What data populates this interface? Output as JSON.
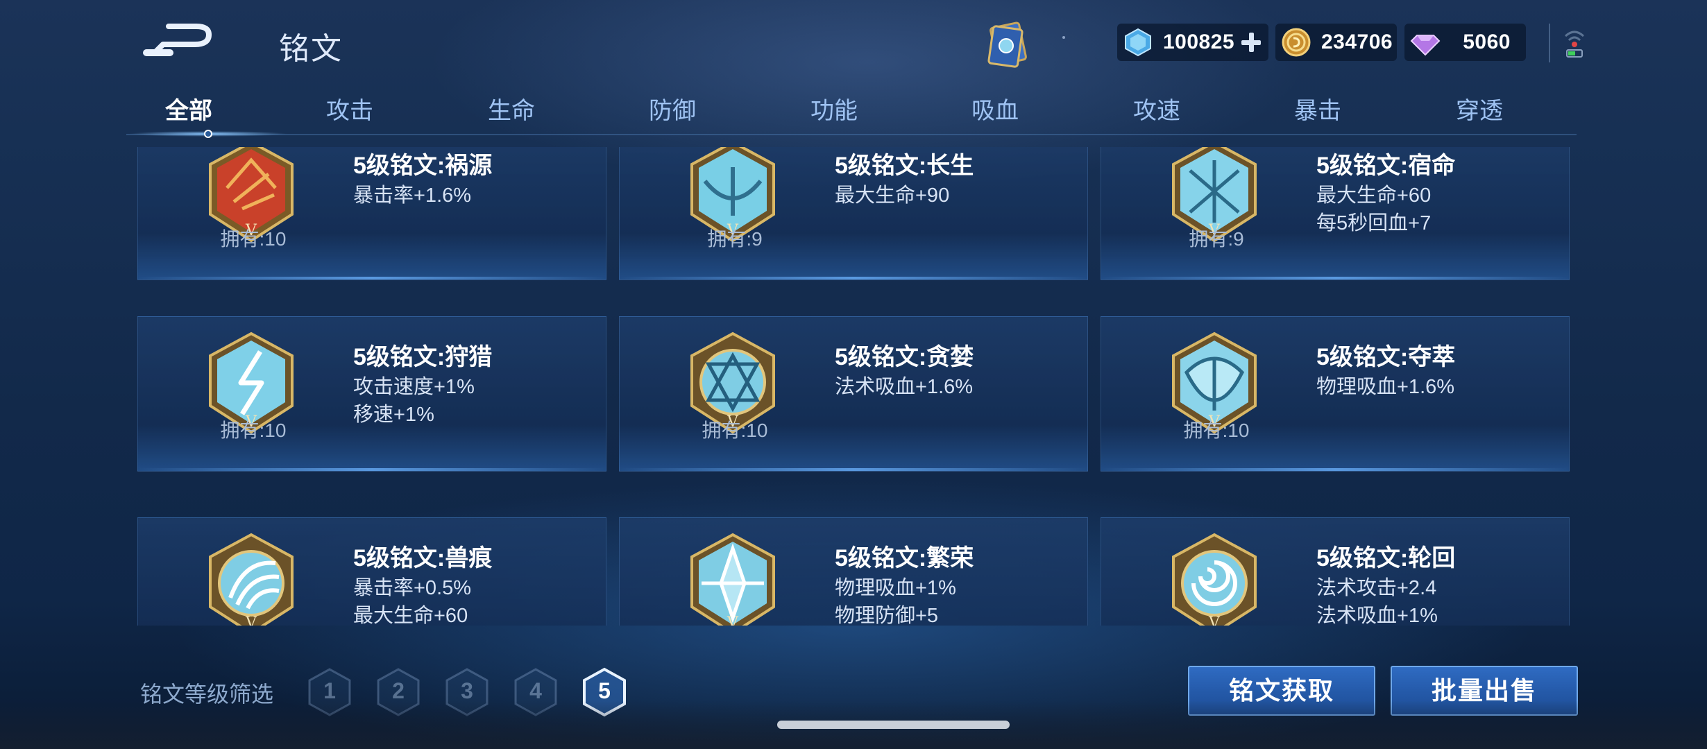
{
  "header": {
    "title": "铭文",
    "back_icon": "back-arrow-icon",
    "book_icon": "inscription-book-icon"
  },
  "currencies": [
    {
      "name": "gem",
      "icon": "blue-gem-icon",
      "amount": "100825",
      "has_plus": true
    },
    {
      "name": "coin",
      "icon": "gold-coin-icon",
      "amount": "234706"
    },
    {
      "name": "diamond",
      "icon": "purple-diamond-icon",
      "amount": "5060"
    }
  ],
  "tabs": [
    {
      "label": "全部",
      "active": true
    },
    {
      "label": "攻击"
    },
    {
      "label": "生命"
    },
    {
      "label": "防御"
    },
    {
      "label": "功能"
    },
    {
      "label": "吸血"
    },
    {
      "label": "攻速"
    },
    {
      "label": "暴击"
    },
    {
      "label": "穿透"
    }
  ],
  "runes": [
    {
      "title": "5级铭文:祸源",
      "stats": [
        "暴击率+1.6%",
        ""
      ],
      "owned": "拥有:10",
      "emblem": "red"
    },
    {
      "title": "5级铭文:长生",
      "stats": [
        "最大生命+90",
        ""
      ],
      "owned": "拥有:9",
      "emblem": "blue"
    },
    {
      "title": "5级铭文:宿命",
      "stats": [
        "最大生命+60",
        "每5秒回血+7"
      ],
      "owned": "拥有:9",
      "emblem": "blue"
    },
    {
      "title": "5级铭文:狩猎",
      "stats": [
        "攻击速度+1%",
        "移速+1%"
      ],
      "owned": "拥有:10",
      "emblem": "blue"
    },
    {
      "title": "5级铭文:贪婪",
      "stats": [
        "法术吸血+1.6%",
        ""
      ],
      "owned": "拥有:10",
      "emblem": "blue"
    },
    {
      "title": "5级铭文:夺萃",
      "stats": [
        "物理吸血+1.6%",
        ""
      ],
      "owned": "拥有:10",
      "emblem": "blue"
    },
    {
      "title": "5级铭文:兽痕",
      "stats": [
        "暴击率+0.5%",
        "最大生命+60"
      ],
      "owned": "",
      "emblem": "blue"
    },
    {
      "title": "5级铭文:繁荣",
      "stats": [
        "物理吸血+1%",
        "物理防御+5"
      ],
      "owned": "",
      "emblem": "blue"
    },
    {
      "title": "5级铭文:轮回",
      "stats": [
        "法术攻击+2.4",
        "法术吸血+1%"
      ],
      "owned": "",
      "emblem": "blue"
    }
  ],
  "footer": {
    "filter_label": "铭文等级筛选",
    "levels": [
      "1",
      "2",
      "3",
      "4",
      "5"
    ],
    "active_level": "5",
    "get_button": "铭文获取",
    "sell_button": "批量出售"
  },
  "colors": {
    "accent_blue": "#2459a8",
    "emblem_red": "#c9412a",
    "emblem_blue": "#79cfe6",
    "gold_frame": "#c9a65a"
  }
}
